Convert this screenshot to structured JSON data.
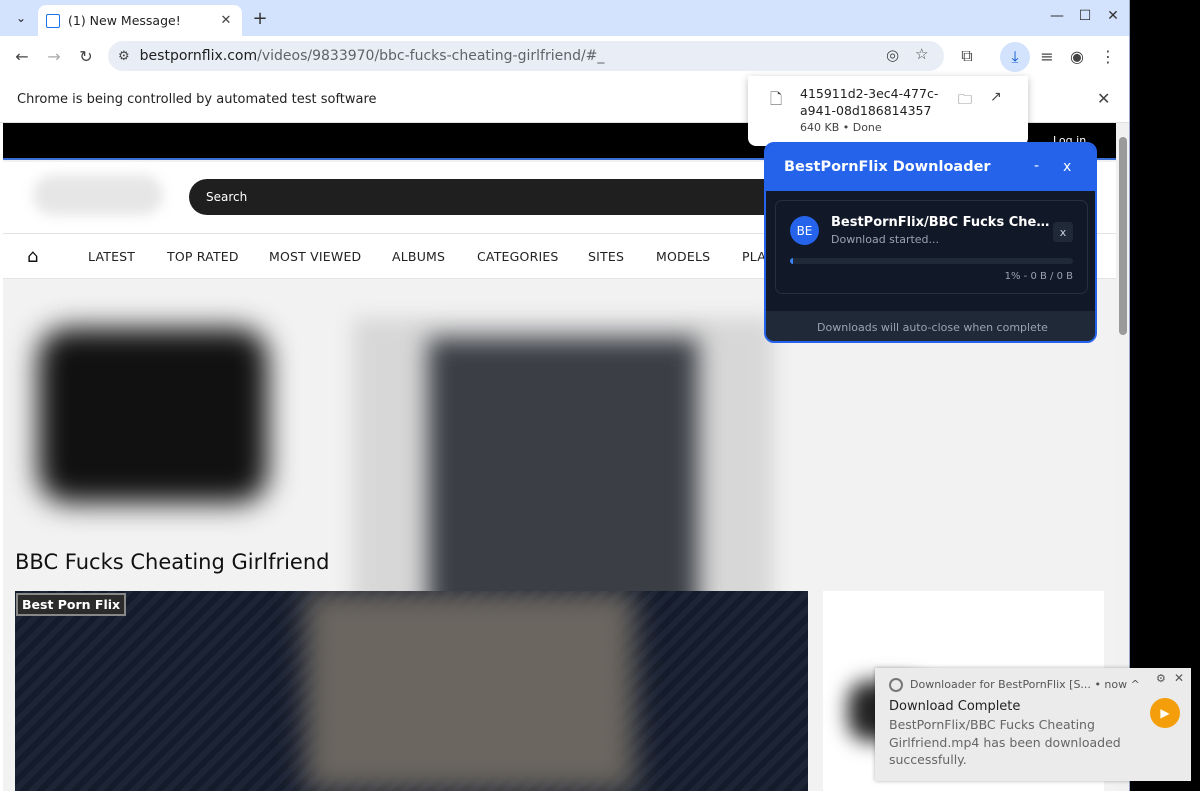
{
  "tab": {
    "title": "(1) New Message!",
    "close": "✕"
  },
  "toolbar": {
    "url_host": "bestpornflix.com",
    "url_path": "/videos/9833970/bbc-fucks-cheating-girlfriend/#_"
  },
  "infobar": {
    "message": "Chrome is being controlled by automated test software"
  },
  "site": {
    "login": "Log in",
    "search_placeholder": "Search",
    "nav": [
      "LATEST",
      "TOP RATED",
      "MOST VIEWED",
      "ALBUMS",
      "CATEGORIES",
      "SITES",
      "MODELS",
      "PLA"
    ],
    "video_title": "BBC Fucks Cheating Girlfriend",
    "player_badge": "Best Porn Flix"
  },
  "download_bubble": {
    "filename": "415911d2-3ec4-477c-a941-08d186814357",
    "meta": "640 KB • Done"
  },
  "extension": {
    "title": "BestPornFlix Downloader",
    "minimize": "-",
    "close": "x",
    "item": {
      "avatar": "BE",
      "title": "BestPornFlix/BBC Fucks Cheating Girlfriend",
      "status": "Download started...",
      "cancel": "x",
      "progress_fraction": 0.01,
      "progress_text": "1% - 0 B / 0 B"
    },
    "footer": "Downloads will auto-close when complete"
  },
  "notification": {
    "source": "Downloader for BestPornFlix [S...",
    "time": "• now ^",
    "title": "Download Complete",
    "body": "BestPornFlix/BBC Fucks Cheating Girlfriend.mp4 has been downloaded successfully."
  },
  "colors": {
    "accent": "#2563eb",
    "panel_bg": "#111827",
    "play": "#f59e0b"
  }
}
